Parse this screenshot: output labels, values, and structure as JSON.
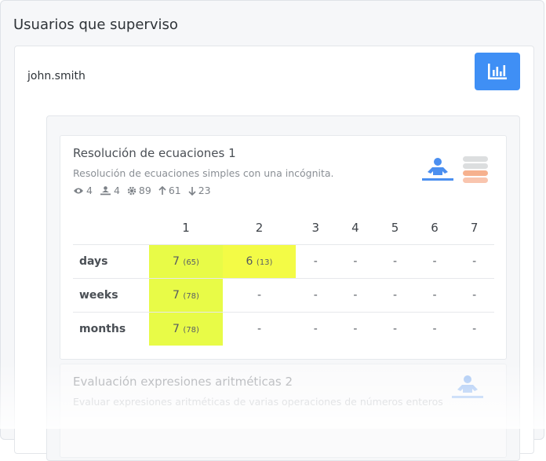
{
  "page": {
    "title": "Usuarios que superviso"
  },
  "user": {
    "name": "john.smith",
    "stats_button_icon": "bar-chart-icon"
  },
  "problems": [
    {
      "title": "Resolución de ecuaciones 1",
      "description": "Resolución de ecuaciones simples con una incógnita.",
      "stats": {
        "views": "4",
        "students": "4",
        "solved": "89",
        "up": "61",
        "down": "23"
      },
      "columns": [
        "1",
        "2",
        "3",
        "4",
        "5",
        "6",
        "7"
      ],
      "rows": [
        {
          "label": "days",
          "cells": [
            {
              "v": "7",
              "s": "(65)"
            },
            {
              "v": "6",
              "s": "(13)"
            },
            {
              "v": "-",
              "s": ""
            },
            {
              "v": "-",
              "s": ""
            },
            {
              "v": "-",
              "s": ""
            },
            {
              "v": "-",
              "s": ""
            },
            {
              "v": "-",
              "s": ""
            }
          ]
        },
        {
          "label": "weeks",
          "cells": [
            {
              "v": "7",
              "s": "(78)"
            },
            {
              "v": "-",
              "s": ""
            },
            {
              "v": "-",
              "s": ""
            },
            {
              "v": "-",
              "s": ""
            },
            {
              "v": "-",
              "s": ""
            },
            {
              "v": "-",
              "s": ""
            },
            {
              "v": "-",
              "s": ""
            }
          ]
        },
        {
          "label": "months",
          "cells": [
            {
              "v": "7",
              "s": "(78)"
            },
            {
              "v": "-",
              "s": ""
            },
            {
              "v": "-",
              "s": ""
            },
            {
              "v": "-",
              "s": ""
            },
            {
              "v": "-",
              "s": ""
            },
            {
              "v": "-",
              "s": ""
            },
            {
              "v": "-",
              "s": ""
            }
          ]
        }
      ]
    },
    {
      "title": "Evaluación expresiones aritméticas 2",
      "description": "Evaluar expresiones aritméticas de varias operaciones de números enteros"
    }
  ],
  "colors": {
    "accent": "#3f8ff5",
    "highlight": "#e8fb47",
    "highlight_alt": "#f3fb46",
    "level_active": "#f7b08a"
  }
}
